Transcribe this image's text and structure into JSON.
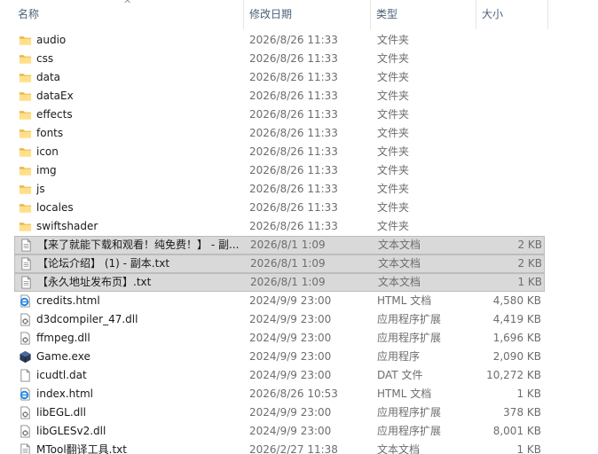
{
  "columns": {
    "name": "名称",
    "date": "修改日期",
    "type": "类型",
    "size": "大小"
  },
  "sort_indicator": "^",
  "files": [
    {
      "name": "audio",
      "date": "2026/8/26 11:33",
      "type": "文件夹",
      "size": "",
      "icon": "folder-icon",
      "selected": false
    },
    {
      "name": "css",
      "date": "2026/8/26 11:33",
      "type": "文件夹",
      "size": "",
      "icon": "folder-icon",
      "selected": false
    },
    {
      "name": "data",
      "date": "2026/8/26 11:33",
      "type": "文件夹",
      "size": "",
      "icon": "folder-icon",
      "selected": false
    },
    {
      "name": "dataEx",
      "date": "2026/8/26 11:33",
      "type": "文件夹",
      "size": "",
      "icon": "folder-icon",
      "selected": false
    },
    {
      "name": "effects",
      "date": "2026/8/26 11:33",
      "type": "文件夹",
      "size": "",
      "icon": "folder-icon",
      "selected": false
    },
    {
      "name": "fonts",
      "date": "2026/8/26 11:33",
      "type": "文件夹",
      "size": "",
      "icon": "folder-icon",
      "selected": false
    },
    {
      "name": "icon",
      "date": "2026/8/26 11:33",
      "type": "文件夹",
      "size": "",
      "icon": "folder-icon",
      "selected": false
    },
    {
      "name": "img",
      "date": "2026/8/26 11:33",
      "type": "文件夹",
      "size": "",
      "icon": "folder-icon",
      "selected": false
    },
    {
      "name": "js",
      "date": "2026/8/26 11:33",
      "type": "文件夹",
      "size": "",
      "icon": "folder-icon",
      "selected": false
    },
    {
      "name": "locales",
      "date": "2026/8/26 11:33",
      "type": "文件夹",
      "size": "",
      "icon": "folder-icon",
      "selected": false
    },
    {
      "name": "swiftshader",
      "date": "2026/8/26 11:33",
      "type": "文件夹",
      "size": "",
      "icon": "folder-icon",
      "selected": false
    },
    {
      "name": "【来了就能下载和观看！纯免费！】 - 副...",
      "date": "2026/8/1 1:09",
      "type": "文本文档",
      "size": "2 KB",
      "icon": "text-file-icon",
      "selected": true
    },
    {
      "name": "【论坛介绍】 (1) - 副本.txt",
      "date": "2026/8/1 1:09",
      "type": "文本文档",
      "size": "2 KB",
      "icon": "text-file-icon",
      "selected": true
    },
    {
      "name": "【永久地址发布页】.txt",
      "date": "2026/8/1 1:09",
      "type": "文本文档",
      "size": "1 KB",
      "icon": "text-file-icon",
      "selected": true
    },
    {
      "name": "credits.html",
      "date": "2024/9/9 23:00",
      "type": "HTML 文档",
      "size": "4,580 KB",
      "icon": "html-file-icon",
      "selected": false
    },
    {
      "name": "d3dcompiler_47.dll",
      "date": "2024/9/9 23:00",
      "type": "应用程序扩展",
      "size": "4,419 KB",
      "icon": "dll-file-icon",
      "selected": false
    },
    {
      "name": "ffmpeg.dll",
      "date": "2024/9/9 23:00",
      "type": "应用程序扩展",
      "size": "1,696 KB",
      "icon": "dll-file-icon",
      "selected": false
    },
    {
      "name": "Game.exe",
      "date": "2024/9/9 23:00",
      "type": "应用程序",
      "size": "2,090 KB",
      "icon": "exe-icon",
      "selected": false
    },
    {
      "name": "icudtl.dat",
      "date": "2024/9/9 23:00",
      "type": "DAT 文件",
      "size": "10,272 KB",
      "icon": "blank-file-icon",
      "selected": false
    },
    {
      "name": "index.html",
      "date": "2026/8/26 10:53",
      "type": "HTML 文档",
      "size": "1 KB",
      "icon": "html-file-icon",
      "selected": false
    },
    {
      "name": "libEGL.dll",
      "date": "2024/9/9 23:00",
      "type": "应用程序扩展",
      "size": "378 KB",
      "icon": "dll-file-icon",
      "selected": false
    },
    {
      "name": "libGLESv2.dll",
      "date": "2024/9/9 23:00",
      "type": "应用程序扩展",
      "size": "8,001 KB",
      "icon": "dll-file-icon",
      "selected": false
    },
    {
      "name": "MTool翻译工具.txt",
      "date": "2026/2/27 11:38",
      "type": "文本文档",
      "size": "1 KB",
      "icon": "text-file-icon",
      "selected": false
    }
  ]
}
